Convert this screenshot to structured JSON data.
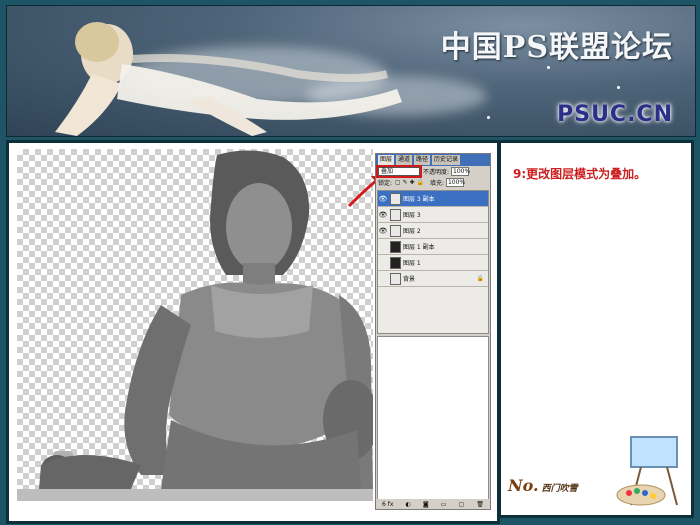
{
  "banner": {
    "title": "中国PS联盟论坛",
    "site": "PSUC.CN"
  },
  "layers_panel": {
    "tabs": [
      "图层",
      "通道",
      "路径",
      "历史记录"
    ],
    "blend_mode": "叠加",
    "opacity_label": "不透明度:",
    "opacity_value": "100%",
    "lock_label": "锁定:",
    "fill_label": "填充:",
    "fill_value": "100%",
    "layers": [
      {
        "name": "图层 3 副本",
        "visible": true,
        "active": true
      },
      {
        "name": "图层 3",
        "visible": true,
        "active": false
      },
      {
        "name": "图层 2",
        "visible": true,
        "active": false
      },
      {
        "name": "图层 1 副本",
        "visible": false,
        "active": false
      },
      {
        "name": "图层 1",
        "visible": false,
        "active": false
      },
      {
        "name": "背景",
        "visible": false,
        "active": false,
        "locked": true
      }
    ],
    "footer_label": "6 fx"
  },
  "info": {
    "step": "9:更改图层模式为叠加。"
  },
  "signature": {
    "text": "No.",
    "sub": "西门吹雪"
  },
  "colors": {
    "frame": "#1d5566",
    "accent_red": "#cc1f1f",
    "layer_active": "#3a6fc2"
  }
}
